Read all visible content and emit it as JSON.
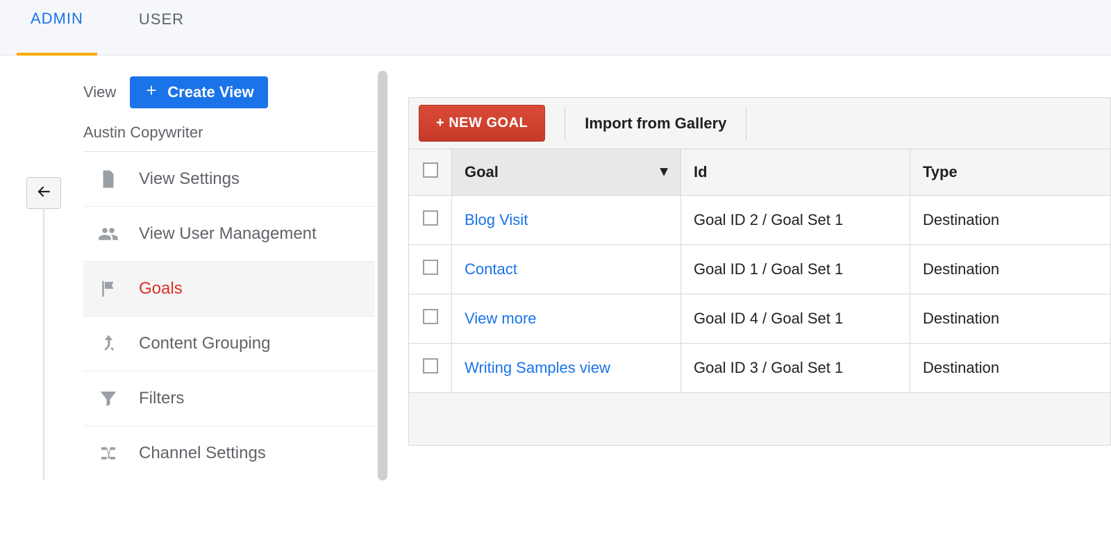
{
  "nav": {
    "admin": "ADMIN",
    "user": "USER"
  },
  "sidebar": {
    "view_label": "View",
    "create_view_label": "Create View",
    "subtitle": "Austin Copywriter",
    "items": [
      {
        "label": "View Settings"
      },
      {
        "label": "View User Management"
      },
      {
        "label": "Goals"
      },
      {
        "label": "Content Grouping"
      },
      {
        "label": "Filters"
      },
      {
        "label": "Channel Settings"
      }
    ]
  },
  "toolbar": {
    "new_goal": "+ NEW GOAL",
    "import": "Import from Gallery"
  },
  "table": {
    "headers": {
      "goal": "Goal",
      "id": "Id",
      "type": "Type"
    },
    "rows": [
      {
        "goal": "Blog Visit",
        "id": "Goal ID 2 / Goal Set 1",
        "type": "Destination"
      },
      {
        "goal": "Contact",
        "id": "Goal ID 1 / Goal Set 1",
        "type": "Destination"
      },
      {
        "goal": "View more",
        "id": "Goal ID 4 / Goal Set 1",
        "type": "Destination"
      },
      {
        "goal": "Writing Samples view",
        "id": "Goal ID 3 / Goal Set 1",
        "type": "Destination"
      }
    ]
  }
}
